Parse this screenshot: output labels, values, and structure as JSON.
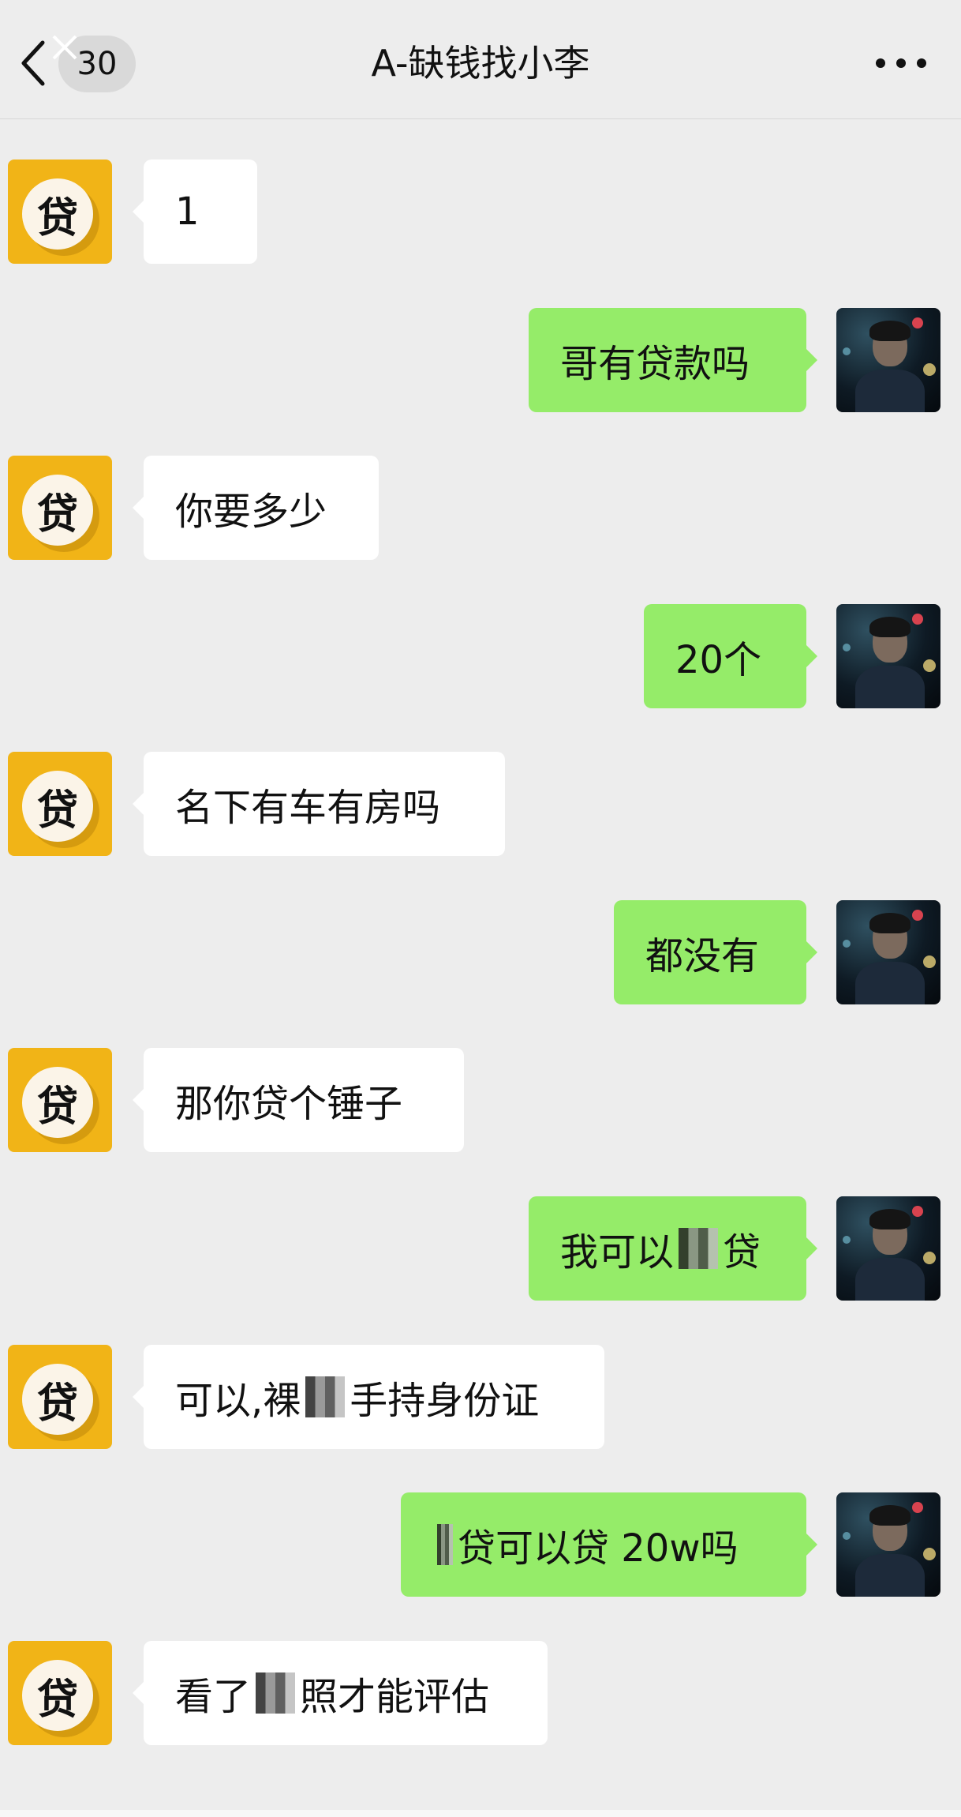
{
  "header": {
    "back_icon": "chevron-left-icon",
    "unread_count": "30",
    "title": "A-缺钱找小李",
    "more_icon": "more-dots-icon"
  },
  "avatars": {
    "contact_glyph": "贷"
  },
  "messages": [
    {
      "side": "left",
      "text": "1"
    },
    {
      "side": "right",
      "text": "哥有贷款吗"
    },
    {
      "side": "left",
      "text": "你要多少"
    },
    {
      "side": "right",
      "text": "20个"
    },
    {
      "side": "left",
      "text": "名下有车有房吗"
    },
    {
      "side": "right",
      "text": "都没有"
    },
    {
      "side": "left",
      "text": "那你贷个锤子"
    },
    {
      "side": "right",
      "text_before": "我可以",
      "text_after": "贷"
    },
    {
      "side": "left",
      "text_before": "可以,裸",
      "text_after": "手持身份证"
    },
    {
      "side": "right",
      "text_before": "",
      "text_after": "贷可以贷 20w吗"
    },
    {
      "side": "left",
      "text_before": "看了",
      "text_after": "照才能评估"
    }
  ],
  "colors": {
    "background": "#ededed",
    "bubble_left": "#ffffff",
    "bubble_right": "#95ec69",
    "loan_avatar": "#f1b417"
  }
}
